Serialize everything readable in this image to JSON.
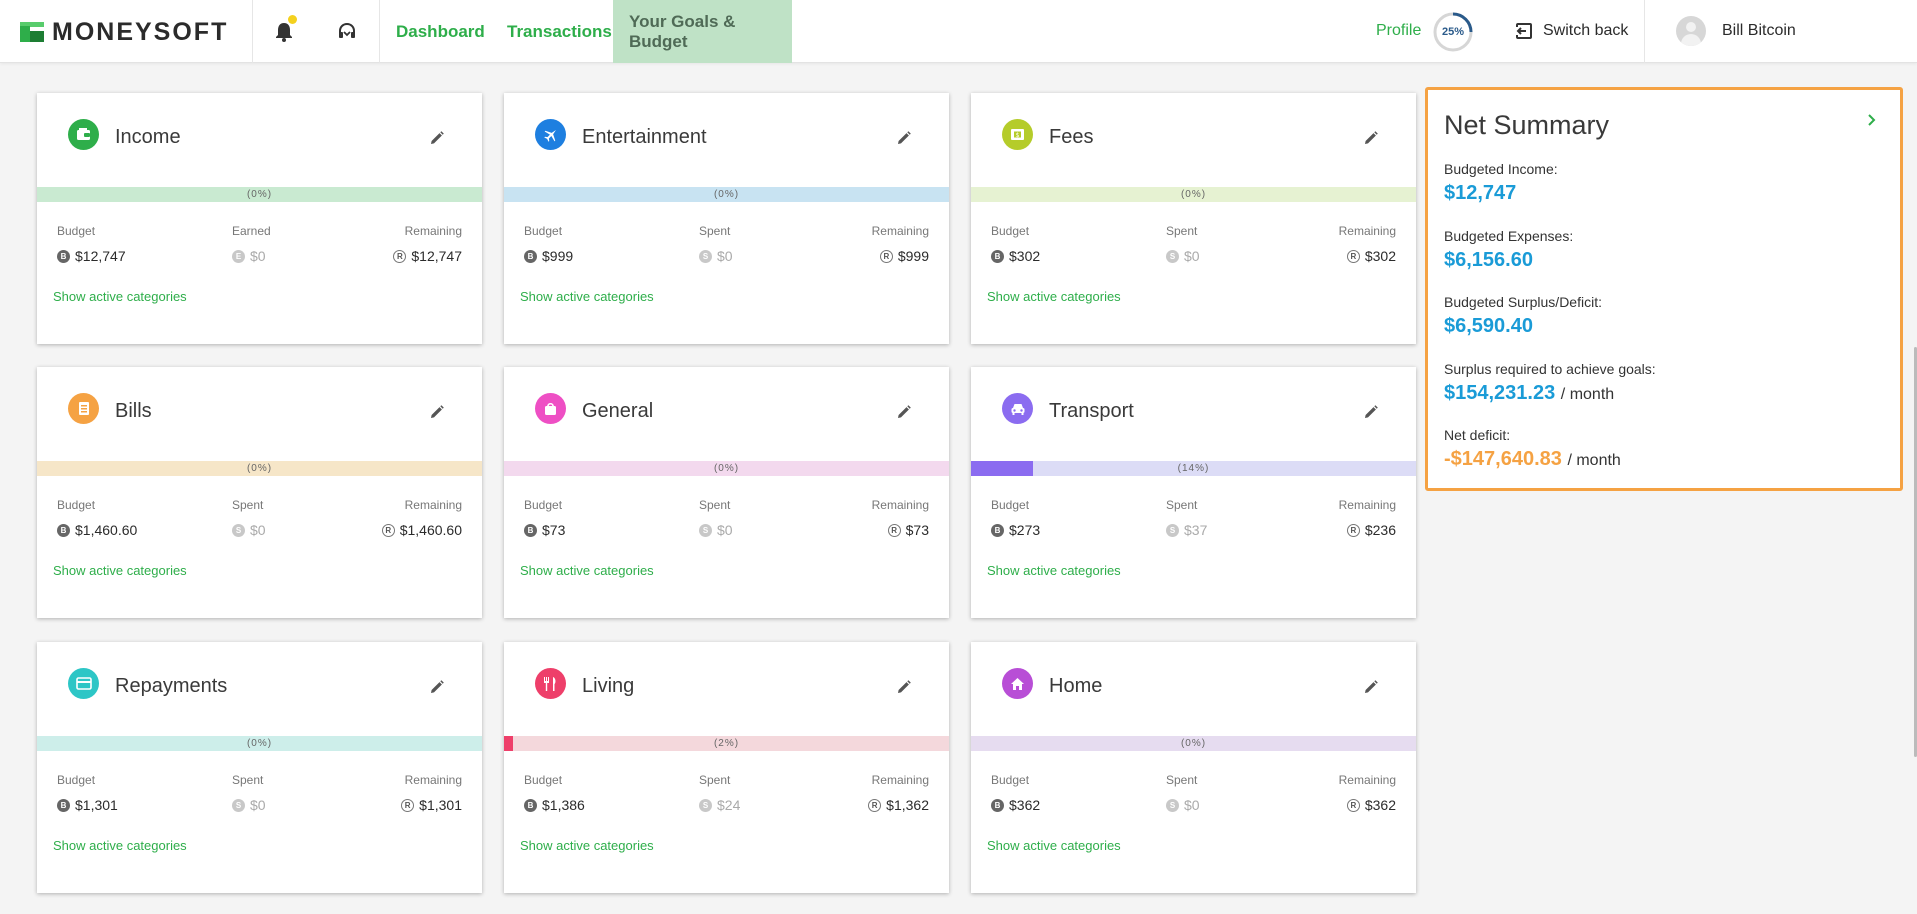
{
  "brand": {
    "name": "MONEYSOFT"
  },
  "header": {
    "nav": [
      {
        "label": "Dashboard",
        "active": false
      },
      {
        "label": "Transactions",
        "active": false
      },
      {
        "label": "Your Goals & Budget",
        "active": true
      }
    ],
    "profile_label": "Profile",
    "profile_completion": "25%",
    "profile_completion_value": 0.25,
    "switch_back_label": "Switch back",
    "user_name": "Bill Bitcoin",
    "icons": [
      "bell-icon",
      "support-headset-icon",
      "switch-back-icon",
      "avatar-icon"
    ]
  },
  "cards": [
    {
      "title": "Income",
      "color": "#2eae4a",
      "bar_bg": "#c9ead1",
      "bar_fill": "#2eae4a",
      "progress": "(0%)",
      "progress_value": 0,
      "col1_label": "Budget",
      "col1_value": "$12,747",
      "col2_label": "Earned",
      "col2_value": "$0",
      "col3_label": "Remaining",
      "col3_value": "$12,747",
      "link": "Show active categories",
      "icon": "wallet-icon"
    },
    {
      "title": "Entertainment",
      "color": "#1e7fe0",
      "bar_bg": "#c8e3f2",
      "bar_fill": "#1e7fe0",
      "progress": "(0%)",
      "progress_value": 0,
      "col1_label": "Budget",
      "col1_value": "$999",
      "col2_label": "Spent",
      "col2_value": "$0",
      "col3_label": "Remaining",
      "col3_value": "$999",
      "link": "Show active categories",
      "icon": "airplane-icon"
    },
    {
      "title": "Fees",
      "color": "#b5cc2a",
      "bar_bg": "#e6f2d2",
      "bar_fill": "#b5cc2a",
      "progress": "(0%)",
      "progress_value": 0,
      "col1_label": "Budget",
      "col1_value": "$302",
      "col2_label": "Spent",
      "col2_value": "$0",
      "col3_label": "Remaining",
      "col3_value": "$302",
      "link": "Show active categories",
      "icon": "cash-icon"
    },
    {
      "title": "Bills",
      "color": "#f5a243",
      "bar_bg": "#f6e6c8",
      "bar_fill": "#f5a243",
      "progress": "(0%)",
      "progress_value": 0,
      "col1_label": "Budget",
      "col1_value": "$1,460.60",
      "col2_label": "Spent",
      "col2_value": "$0",
      "col3_label": "Remaining",
      "col3_value": "$1,460.60",
      "link": "Show active categories",
      "icon": "receipt-icon"
    },
    {
      "title": "General",
      "color": "#ee4fc4",
      "bar_bg": "#f3d9ee",
      "bar_fill": "#ee4fc4",
      "progress": "(0%)",
      "progress_value": 0,
      "col1_label": "Budget",
      "col1_value": "$73",
      "col2_label": "Spent",
      "col2_value": "$0",
      "col3_label": "Remaining",
      "col3_value": "$73",
      "link": "Show active categories",
      "icon": "shopping-bag-icon"
    },
    {
      "title": "Transport",
      "color": "#8b6cf0",
      "bar_bg": "#dcdcf6",
      "bar_fill": "#8b6cf0",
      "progress": "(14%)",
      "progress_value": 0.14,
      "col1_label": "Budget",
      "col1_value": "$273",
      "col2_label": "Spent",
      "col2_value": "$37",
      "col3_label": "Remaining",
      "col3_value": "$236",
      "link": "Show active categories",
      "icon": "car-icon"
    },
    {
      "title": "Repayments",
      "color": "#2dc6c6",
      "bar_bg": "#cdeeea",
      "bar_fill": "#2dc6c6",
      "progress": "(0%)",
      "progress_value": 0,
      "col1_label": "Budget",
      "col1_value": "$1,301",
      "col2_label": "Spent",
      "col2_value": "$0",
      "col3_label": "Remaining",
      "col3_value": "$1,301",
      "link": "Show active categories",
      "icon": "credit-card-icon"
    },
    {
      "title": "Living",
      "color": "#ee3f6a",
      "bar_bg": "#f4d8dc",
      "bar_fill": "#ee3f6a",
      "progress": "(2%)",
      "progress_value": 0.02,
      "col1_label": "Budget",
      "col1_value": "$1,386",
      "col2_label": "Spent",
      "col2_value": "$24",
      "col3_label": "Remaining",
      "col3_value": "$1,362",
      "link": "Show active categories",
      "icon": "cutlery-icon"
    },
    {
      "title": "Home",
      "color": "#b84ed6",
      "bar_bg": "#e6dcf0",
      "bar_fill": "#b84ed6",
      "progress": "(0%)",
      "progress_value": 0,
      "col1_label": "Budget",
      "col1_value": "$362",
      "col2_label": "Spent",
      "col2_value": "$0",
      "col3_label": "Remaining",
      "col3_value": "$362",
      "link": "Show active categories",
      "icon": "house-icon"
    }
  ],
  "summary": {
    "title": "Net Summary",
    "budgeted_income_label": "Budgeted Income:",
    "budgeted_income": "$12,747",
    "budgeted_expenses_label": "Budgeted Expenses:",
    "budgeted_expenses": "$6,156.60",
    "surplus_label": "Budgeted Surplus/Deficit:",
    "surplus": "$6,590.40",
    "required_label": "Surplus required to achieve goals:",
    "required": "$154,231.23",
    "per_month": "/ month",
    "net_deficit_label": "Net deficit:",
    "net_deficit": "-$147,640.83"
  },
  "colors": {
    "accent_green": "#2eae4a",
    "value_blue": "#1a9bd7",
    "deficit_orange": "#f5a243"
  }
}
